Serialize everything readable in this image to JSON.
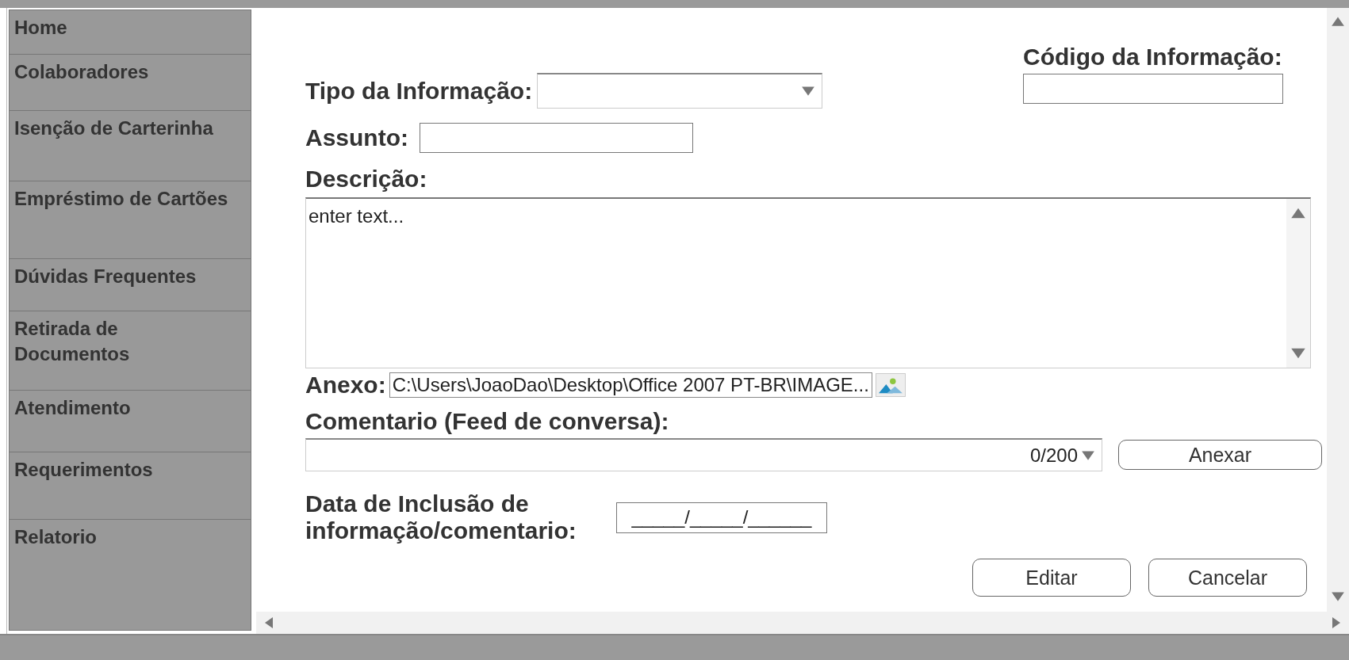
{
  "sidebar": {
    "items": [
      {
        "label": "Home"
      },
      {
        "label": "Colaboradores"
      },
      {
        "label": "Isenção de Carterinha"
      },
      {
        "label": "Empréstimo de Cartões"
      },
      {
        "label": "Dúvidas Frequentes"
      },
      {
        "label": "Retirada de Documentos"
      },
      {
        "label": "Atendimento"
      },
      {
        "label": "Requerimentos"
      },
      {
        "label": "Relatorio"
      }
    ]
  },
  "form": {
    "codigo": {
      "label": "Código da Informação:"
    },
    "tipo": {
      "label": "Tipo da Informação:"
    },
    "assunto": {
      "label": "Assunto:"
    },
    "descricao": {
      "label": "Descrição:",
      "placeholder": "enter text..."
    },
    "anexo": {
      "label": "Anexo:",
      "value": "C:\\Users\\JoaoDao\\Desktop\\Office 2007 PT-BR\\IMAGE..."
    },
    "comentario": {
      "label": "Comentario (Feed de conversa):",
      "counter": "0/200",
      "button": "Anexar"
    },
    "data": {
      "label": "Data de Inclusão de informação/comentario:",
      "value": "_____/_____/______"
    }
  },
  "buttons": [
    "Editar",
    "Cancelar"
  ]
}
